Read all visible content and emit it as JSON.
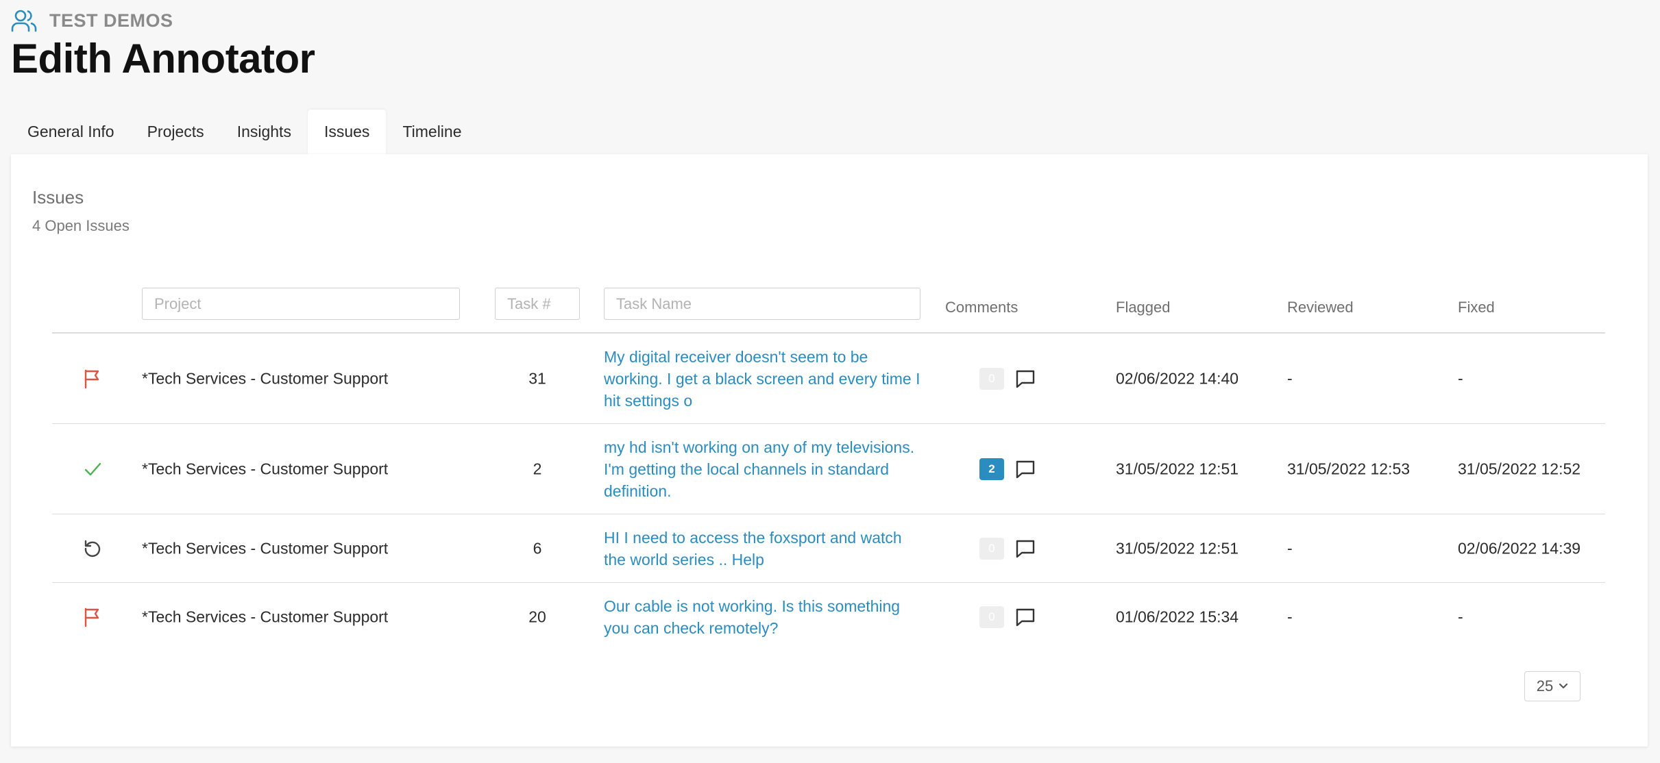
{
  "header": {
    "org_icon": "users-icon",
    "org_name": "TEST DEMOS",
    "user_name": "Edith Annotator"
  },
  "tabs": [
    {
      "label": "General Info",
      "active": false
    },
    {
      "label": "Projects",
      "active": false
    },
    {
      "label": "Insights",
      "active": false
    },
    {
      "label": "Issues",
      "active": true
    },
    {
      "label": "Timeline",
      "active": false
    }
  ],
  "issues": {
    "title": "Issues",
    "subtitle": "4 Open Issues",
    "filters": {
      "project_placeholder": "Project",
      "task_placeholder": "Task #",
      "taskname_placeholder": "Task Name"
    },
    "columns": {
      "comments": "Comments",
      "flagged": "Flagged",
      "reviewed": "Reviewed",
      "fixed": "Fixed"
    },
    "rows": [
      {
        "status": "flag-icon",
        "project": "*Tech Services - Customer Support",
        "task": "31",
        "task_name": "My digital receiver doesn't seem to be working. I get a black screen and every time I hit settings o",
        "comments": "0",
        "flagged": "02/06/2022 14:40",
        "reviewed": "-",
        "fixed": "-"
      },
      {
        "status": "check-icon",
        "project": "*Tech Services - Customer Support",
        "task": "2",
        "task_name": "my hd isn't working on any of my televisions. I'm getting the local channels in standard definition.",
        "comments": "2",
        "flagged": "31/05/2022 12:51",
        "reviewed": "31/05/2022 12:53",
        "fixed": "31/05/2022 12:52"
      },
      {
        "status": "reopen-icon",
        "project": "*Tech Services - Customer Support",
        "task": "6",
        "task_name": "HI I need to access the foxsport and watch the world series .. Help",
        "comments": "0",
        "flagged": "31/05/2022 12:51",
        "reviewed": "-",
        "fixed": "02/06/2022 14:39"
      },
      {
        "status": "flag-icon",
        "project": "*Tech Services - Customer Support",
        "task": "20",
        "task_name": "Our cable is not working. Is this something you can check remotely?",
        "comments": "0",
        "flagged": "01/06/2022 15:34",
        "reviewed": "-",
        "fixed": "-"
      }
    ],
    "page_size": "25"
  },
  "colors": {
    "accent": "#2a8cbf",
    "flag": "#e0533f",
    "check": "#4caf50",
    "reopen": "#444444"
  }
}
